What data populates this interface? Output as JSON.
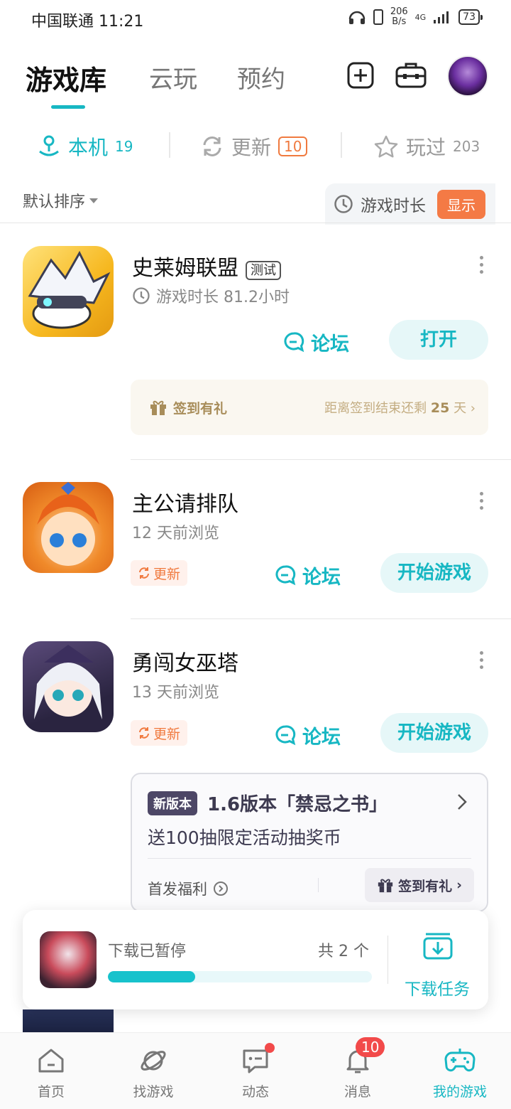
{
  "status_bar": {
    "carrier_time": "中国联通 11:21",
    "speed_value": "206",
    "speed_unit": "B/s",
    "network": "4G",
    "battery": "73"
  },
  "top_tabs": [
    {
      "label": "游戏库"
    },
    {
      "label": "云玩"
    },
    {
      "label": "预约"
    }
  ],
  "sub_tabs": {
    "local": {
      "label": "本机",
      "count": "19"
    },
    "update": {
      "label": "更新",
      "count": "10"
    },
    "played": {
      "label": "玩过",
      "count": "203"
    }
  },
  "sort_label": "默认排序",
  "play_time": {
    "label": "游戏时长",
    "button": "显示"
  },
  "games": [
    {
      "name": "史莱姆联盟",
      "tag": "测试",
      "subtitle": "游戏时长 81.2小时",
      "forum": "论坛",
      "action": "打开",
      "sign": {
        "label": "签到有礼",
        "prefix": "距离签到结束还剩",
        "days": "25",
        "suffix": "天"
      }
    },
    {
      "name": "主公请排队",
      "subtitle": "12 天前浏览",
      "update_tag": "更新",
      "forum": "论坛",
      "action": "开始游戏"
    },
    {
      "name": "勇闯女巫塔",
      "subtitle": "13 天前浏览",
      "update_tag": "更新",
      "forum": "论坛",
      "action": "开始游戏",
      "version_card": {
        "tag": "新版本",
        "title": "1.6版本「禁忌之书」",
        "desc": "送100抽限定活动抽奖币",
        "bonus": "首发福利",
        "sign": "签到有礼"
      }
    }
  ],
  "download": {
    "status": "下载已暂停",
    "count": "共 2 个",
    "progress": 0.33,
    "task_label": "下载任务"
  },
  "bottom_nav": [
    {
      "label": "首页"
    },
    {
      "label": "找游戏"
    },
    {
      "label": "动态"
    },
    {
      "label": "消息",
      "badge": "10"
    },
    {
      "label": "我的游戏"
    }
  ],
  "colors": {
    "accent": "#17b7c3",
    "orange": "#f07a3f",
    "red": "#f24a4a"
  }
}
